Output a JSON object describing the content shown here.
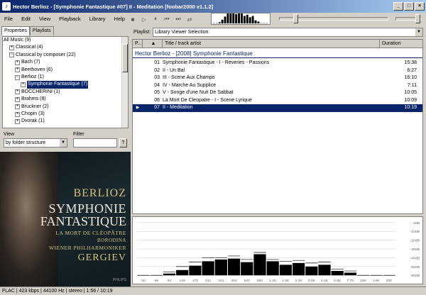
{
  "window": {
    "title": "Hector Berlioz - [Symphonie Fantastique #07] II - Meditation  [foobar2000 v1.1.2]",
    "app_icon": "foobar-icon",
    "minimize": "_",
    "maximize": "□",
    "close": "×"
  },
  "menu": [
    {
      "name": "file",
      "label": "File"
    },
    {
      "name": "edit",
      "label": "Edit"
    },
    {
      "name": "view",
      "label": "View"
    },
    {
      "name": "playback",
      "label": "Playback"
    },
    {
      "name": "library",
      "label": "Library"
    },
    {
      "name": "help",
      "label": "Help"
    }
  ],
  "toolbar": {
    "buttons": [
      {
        "name": "stop-icon",
        "glyph": "■"
      },
      {
        "name": "play-icon",
        "glyph": "▷"
      },
      {
        "name": "pause-icon",
        "glyph": "⏸"
      },
      {
        "name": "previous-icon",
        "glyph": "⏮"
      },
      {
        "name": "next-icon",
        "glyph": "⏭"
      },
      {
        "name": "random-icon",
        "glyph": "⇄"
      }
    ],
    "seek_position": 0.13,
    "volume_level": 1.0
  },
  "left_tabs": [
    {
      "label": "Properties",
      "active": true
    },
    {
      "label": "Playlists",
      "active": false
    }
  ],
  "tree": [
    {
      "indent": 0,
      "exp": "",
      "label": "All Music (9)"
    },
    {
      "indent": 1,
      "exp": "+",
      "label": "Classical (4)"
    },
    {
      "indent": 1,
      "exp": "−",
      "label": "Classical by composer (22)"
    },
    {
      "indent": 2,
      "exp": "+",
      "label": "Bach (7)"
    },
    {
      "indent": 2,
      "exp": "+",
      "label": "Beethoven (6)"
    },
    {
      "indent": 2,
      "exp": "−",
      "label": "Berlioz (1)"
    },
    {
      "indent": 3,
      "exp": "+",
      "label": "Symphonie Fantastique (7)",
      "selected": true
    },
    {
      "indent": 2,
      "exp": "+",
      "label": "BOCCHERINI (1)"
    },
    {
      "indent": 2,
      "exp": "+",
      "label": "Brahms (8)"
    },
    {
      "indent": 2,
      "exp": "+",
      "label": "Bruckner (2)"
    },
    {
      "indent": 2,
      "exp": "+",
      "label": "Chopin (3)"
    },
    {
      "indent": 2,
      "exp": "+",
      "label": "Dvorak (1)"
    }
  ],
  "view": {
    "label": "View",
    "value": "by folder structure",
    "filter_label": "Filter",
    "filter_value": "",
    "help": "?"
  },
  "cover": {
    "line1": "BERLIOZ",
    "line2": "SYMPHONIE",
    "line3": "FANTASTIQUE",
    "line4": "LA MORT DE CLÉOPÂTRE",
    "line5": "BORODINA",
    "line6": "WIENER PHILHARMONIKER",
    "line7": "GERGIEV",
    "brand": "PHILIPS"
  },
  "playlist": {
    "label": "Playlist:",
    "selected": "Library Viewer Selection",
    "columns": {
      "play": "P...",
      "sort": "▲",
      "title": "Title / track artist",
      "duration": "Duration"
    },
    "group": "Hector Berlioz - [2008] Symphonie Fantastique",
    "tracks": [
      {
        "num": "01",
        "title": "Symphonie Fantastique - I - Reveries - Passions",
        "dur": "15:38"
      },
      {
        "num": "02",
        "title": "II - Un Bal",
        "dur": "6:27"
      },
      {
        "num": "03",
        "title": "III - Scene Aux Champs",
        "dur": "16:10"
      },
      {
        "num": "04",
        "title": "IV - Marche Au Supplice",
        "dur": "7:11"
      },
      {
        "num": "05",
        "title": "V - Songe d'une Nuit De Sabbat",
        "dur": "10:05"
      },
      {
        "num": "06",
        "title": "La Mort De Cleopatre - I - Scene Lyrique",
        "dur": "10:09"
      },
      {
        "num": "07",
        "title": "II - Meditation",
        "dur": "10:19",
        "playing": true,
        "marker": "▶"
      }
    ]
  },
  "spectrum": {
    "db_labels": [
      "0dB",
      "-10dB",
      "-20dB",
      "-30dB",
      "-40dB",
      "-50dB",
      "-60dB"
    ],
    "freq_labels": [
      "50",
      "69",
      "94",
      "129",
      "176",
      "241",
      "331",
      "453",
      "620",
      "850",
      "1.2K",
      "1.6K",
      "2.2K",
      "3.0K",
      "4.1K",
      "5.6K",
      "7.7K",
      "10K",
      "14K",
      "20K"
    ],
    "levels_db": [
      -60,
      -60,
      -58,
      -54,
      -49,
      -44,
      -42,
      -41,
      -45,
      -36,
      -44,
      -48,
      -46,
      -50,
      -48,
      -55,
      -57,
      -60,
      -60,
      -60
    ],
    "peaks_db": [
      -60,
      -60,
      -56,
      -50,
      -45,
      -40,
      -40,
      -38,
      -42,
      -34,
      -42,
      -44,
      -43,
      -46,
      -45,
      -53,
      -55,
      -60,
      -60,
      -60
    ]
  },
  "status": "FLAC | 423 kbps | 44100 Hz | stereo | 1:56 / 10:19"
}
